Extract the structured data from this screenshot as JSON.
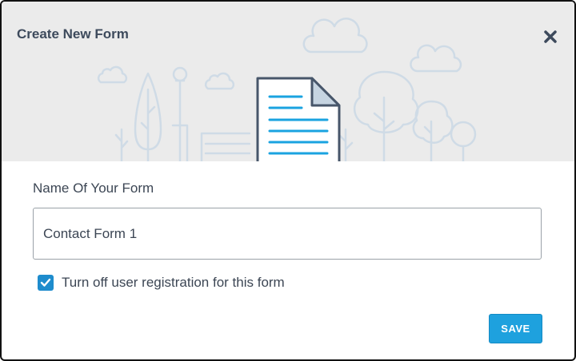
{
  "dialog": {
    "title": "Create New Form",
    "close_icon": "close-icon",
    "illustration_icon": "document-icon"
  },
  "form": {
    "name_label": "Name Of Your Form",
    "name_value": "Contact Form 1",
    "checkbox_label": "Turn off user registration for this form",
    "checkbox_checked": true,
    "save_label": "SAVE"
  },
  "colors": {
    "header_bg": "#ebebeb",
    "accent": "#1ea1de",
    "checkbox": "#1e8ccd",
    "text": "#3c4654"
  }
}
